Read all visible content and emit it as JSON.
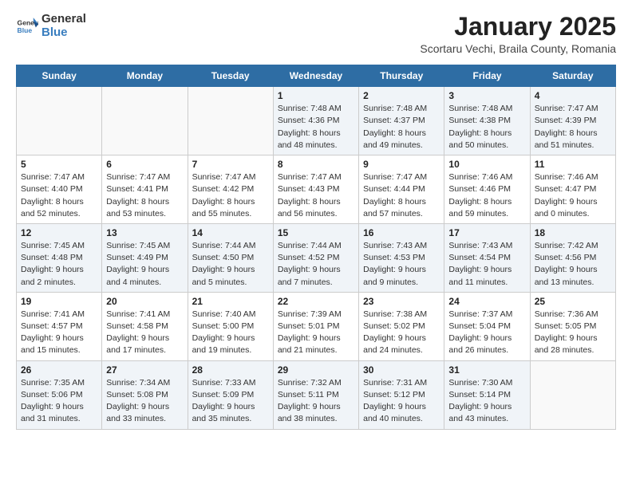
{
  "header": {
    "logo_general": "General",
    "logo_blue": "Blue",
    "month_title": "January 2025",
    "subtitle": "Scortaru Vechi, Braila County, Romania"
  },
  "weekdays": [
    "Sunday",
    "Monday",
    "Tuesday",
    "Wednesday",
    "Thursday",
    "Friday",
    "Saturday"
  ],
  "weeks": [
    [
      {
        "day": "",
        "info": ""
      },
      {
        "day": "",
        "info": ""
      },
      {
        "day": "",
        "info": ""
      },
      {
        "day": "1",
        "info": "Sunrise: 7:48 AM\nSunset: 4:36 PM\nDaylight: 8 hours\nand 48 minutes."
      },
      {
        "day": "2",
        "info": "Sunrise: 7:48 AM\nSunset: 4:37 PM\nDaylight: 8 hours\nand 49 minutes."
      },
      {
        "day": "3",
        "info": "Sunrise: 7:48 AM\nSunset: 4:38 PM\nDaylight: 8 hours\nand 50 minutes."
      },
      {
        "day": "4",
        "info": "Sunrise: 7:47 AM\nSunset: 4:39 PM\nDaylight: 8 hours\nand 51 minutes."
      }
    ],
    [
      {
        "day": "5",
        "info": "Sunrise: 7:47 AM\nSunset: 4:40 PM\nDaylight: 8 hours\nand 52 minutes."
      },
      {
        "day": "6",
        "info": "Sunrise: 7:47 AM\nSunset: 4:41 PM\nDaylight: 8 hours\nand 53 minutes."
      },
      {
        "day": "7",
        "info": "Sunrise: 7:47 AM\nSunset: 4:42 PM\nDaylight: 8 hours\nand 55 minutes."
      },
      {
        "day": "8",
        "info": "Sunrise: 7:47 AM\nSunset: 4:43 PM\nDaylight: 8 hours\nand 56 minutes."
      },
      {
        "day": "9",
        "info": "Sunrise: 7:47 AM\nSunset: 4:44 PM\nDaylight: 8 hours\nand 57 minutes."
      },
      {
        "day": "10",
        "info": "Sunrise: 7:46 AM\nSunset: 4:46 PM\nDaylight: 8 hours\nand 59 minutes."
      },
      {
        "day": "11",
        "info": "Sunrise: 7:46 AM\nSunset: 4:47 PM\nDaylight: 9 hours\nand 0 minutes."
      }
    ],
    [
      {
        "day": "12",
        "info": "Sunrise: 7:45 AM\nSunset: 4:48 PM\nDaylight: 9 hours\nand 2 minutes."
      },
      {
        "day": "13",
        "info": "Sunrise: 7:45 AM\nSunset: 4:49 PM\nDaylight: 9 hours\nand 4 minutes."
      },
      {
        "day": "14",
        "info": "Sunrise: 7:44 AM\nSunset: 4:50 PM\nDaylight: 9 hours\nand 5 minutes."
      },
      {
        "day": "15",
        "info": "Sunrise: 7:44 AM\nSunset: 4:52 PM\nDaylight: 9 hours\nand 7 minutes."
      },
      {
        "day": "16",
        "info": "Sunrise: 7:43 AM\nSunset: 4:53 PM\nDaylight: 9 hours\nand 9 minutes."
      },
      {
        "day": "17",
        "info": "Sunrise: 7:43 AM\nSunset: 4:54 PM\nDaylight: 9 hours\nand 11 minutes."
      },
      {
        "day": "18",
        "info": "Sunrise: 7:42 AM\nSunset: 4:56 PM\nDaylight: 9 hours\nand 13 minutes."
      }
    ],
    [
      {
        "day": "19",
        "info": "Sunrise: 7:41 AM\nSunset: 4:57 PM\nDaylight: 9 hours\nand 15 minutes."
      },
      {
        "day": "20",
        "info": "Sunrise: 7:41 AM\nSunset: 4:58 PM\nDaylight: 9 hours\nand 17 minutes."
      },
      {
        "day": "21",
        "info": "Sunrise: 7:40 AM\nSunset: 5:00 PM\nDaylight: 9 hours\nand 19 minutes."
      },
      {
        "day": "22",
        "info": "Sunrise: 7:39 AM\nSunset: 5:01 PM\nDaylight: 9 hours\nand 21 minutes."
      },
      {
        "day": "23",
        "info": "Sunrise: 7:38 AM\nSunset: 5:02 PM\nDaylight: 9 hours\nand 24 minutes."
      },
      {
        "day": "24",
        "info": "Sunrise: 7:37 AM\nSunset: 5:04 PM\nDaylight: 9 hours\nand 26 minutes."
      },
      {
        "day": "25",
        "info": "Sunrise: 7:36 AM\nSunset: 5:05 PM\nDaylight: 9 hours\nand 28 minutes."
      }
    ],
    [
      {
        "day": "26",
        "info": "Sunrise: 7:35 AM\nSunset: 5:06 PM\nDaylight: 9 hours\nand 31 minutes."
      },
      {
        "day": "27",
        "info": "Sunrise: 7:34 AM\nSunset: 5:08 PM\nDaylight: 9 hours\nand 33 minutes."
      },
      {
        "day": "28",
        "info": "Sunrise: 7:33 AM\nSunset: 5:09 PM\nDaylight: 9 hours\nand 35 minutes."
      },
      {
        "day": "29",
        "info": "Sunrise: 7:32 AM\nSunset: 5:11 PM\nDaylight: 9 hours\nand 38 minutes."
      },
      {
        "day": "30",
        "info": "Sunrise: 7:31 AM\nSunset: 5:12 PM\nDaylight: 9 hours\nand 40 minutes."
      },
      {
        "day": "31",
        "info": "Sunrise: 7:30 AM\nSunset: 5:14 PM\nDaylight: 9 hours\nand 43 minutes."
      },
      {
        "day": "",
        "info": ""
      }
    ]
  ]
}
